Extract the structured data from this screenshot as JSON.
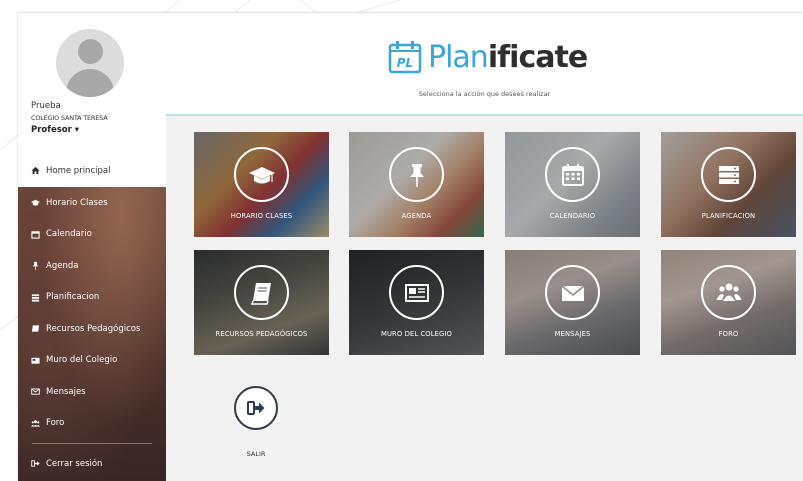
{
  "profile": {
    "name": "Prueba",
    "school": "COLEGIO SANTA TERESA",
    "role": "Profesor ▾"
  },
  "sidebar": {
    "items": [
      {
        "label": "Home principal",
        "icon": "home-icon",
        "active": true
      },
      {
        "label": "Horario Clases",
        "icon": "graduation-cap-icon"
      },
      {
        "label": "Calendario",
        "icon": "calendar-icon"
      },
      {
        "label": "Agenda",
        "icon": "pushpin-icon"
      },
      {
        "label": "Planificacion",
        "icon": "list-icon"
      },
      {
        "label": "Recursos Pedagógicos",
        "icon": "book-icon"
      },
      {
        "label": "Muro del Colegio",
        "icon": "newspaper-icon"
      },
      {
        "label": "Mensajes",
        "icon": "envelope-icon"
      },
      {
        "label": "Foro",
        "icon": "users-icon"
      }
    ],
    "logout": {
      "label": "Cerrar sesión",
      "icon": "sign-out-icon"
    }
  },
  "header": {
    "logo_badge": "PL",
    "logo_part1": "Plan",
    "logo_part2": "ificate",
    "subtitle": "Selecciona la acción que desees realizar"
  },
  "tiles": [
    {
      "label": "HORARIO CLASES",
      "icon": "graduation-cap-icon"
    },
    {
      "label": "AGENDA",
      "icon": "pushpin-icon"
    },
    {
      "label": "CALENDARIO",
      "icon": "calendar-icon"
    },
    {
      "label": "PLANIFICACION",
      "icon": "server-list-icon"
    },
    {
      "label": "RECURSOS PEDAGÓGICOS",
      "icon": "book-icon"
    },
    {
      "label": "MURO DEL COLEGIO",
      "icon": "newspaper-icon"
    },
    {
      "label": "MENSAJES",
      "icon": "envelope-icon"
    },
    {
      "label": "FORO",
      "icon": "users-icon"
    }
  ],
  "exit": {
    "label": "SALIR",
    "icon": "sign-out-icon"
  },
  "colors": {
    "brand_blue": "#3aa7d8",
    "brand_dark": "#2e2e2e",
    "header_border": "#b7e2e6"
  }
}
